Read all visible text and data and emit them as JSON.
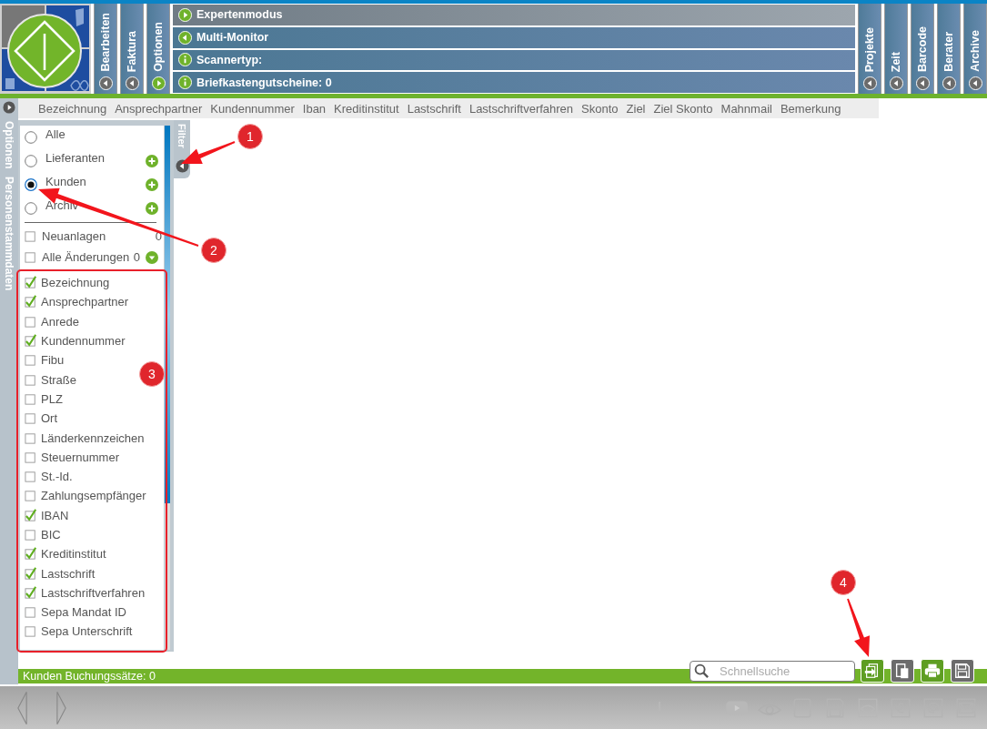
{
  "left_tabs": [
    {
      "label": "Bearbeiten",
      "kind": "back"
    },
    {
      "label": "Faktura",
      "kind": "back"
    },
    {
      "label": "Optionen",
      "kind": "forward"
    }
  ],
  "menu_rows": [
    {
      "label": "Expertenmodus",
      "kind": "forward",
      "highlighted": true
    },
    {
      "label": "Multi-Monitor",
      "kind": "back",
      "highlighted": false
    },
    {
      "label": "Scannertyp:",
      "kind": "info",
      "highlighted": false
    },
    {
      "label": "Briefkastengutscheine: 0",
      "kind": "info",
      "highlighted": false
    }
  ],
  "right_tabs": [
    {
      "label": "Projekte",
      "kind": "back"
    },
    {
      "label": "Zeit",
      "kind": "back"
    },
    {
      "label": "Barcode",
      "kind": "back"
    },
    {
      "label": "Berater",
      "kind": "back"
    },
    {
      "label": "Archive",
      "kind": "back"
    }
  ],
  "columns": [
    "Bezeichnung",
    "Ansprechpartner",
    "Kundennummer",
    "Iban",
    "Kreditinstitut",
    "Lastschrift",
    "Lastschriftverfahren",
    "Skonto",
    "Ziel",
    "Ziel Skonto",
    "Mahnmail",
    "Bemerkung"
  ],
  "side_strip": [
    "Optionen",
    "Personenstammdaten"
  ],
  "filter": {
    "tab_label": "Filter",
    "categories": [
      {
        "label": "Alle",
        "selected": false,
        "addable": false
      },
      {
        "label": "Lieferanten",
        "selected": false,
        "addable": true
      },
      {
        "label": "Kunden",
        "selected": true,
        "addable": true
      },
      {
        "label": "Archiv",
        "selected": false,
        "addable": true
      }
    ],
    "flags": [
      {
        "label": "Neuanlagen",
        "count": "0",
        "checked": false,
        "expandable": false
      },
      {
        "label": "Alle Änderungen",
        "count": "0",
        "checked": false,
        "expandable": true
      }
    ],
    "fields": [
      {
        "label": "Bezeichnung",
        "checked": true
      },
      {
        "label": "Ansprechpartner",
        "checked": true
      },
      {
        "label": "Anrede",
        "checked": false
      },
      {
        "label": "Kundennummer",
        "checked": true
      },
      {
        "label": "Fibu",
        "checked": false
      },
      {
        "label": "Straße",
        "checked": false
      },
      {
        "label": "PLZ",
        "checked": false
      },
      {
        "label": "Ort",
        "checked": false
      },
      {
        "label": "Länderkennzeichen",
        "checked": false
      },
      {
        "label": "Steuernummer",
        "checked": false
      },
      {
        "label": "St.-Id.",
        "checked": false
      },
      {
        "label": "Zahlungsempfänger",
        "checked": false
      },
      {
        "label": "IBAN",
        "checked": true
      },
      {
        "label": "BIC",
        "checked": false
      },
      {
        "label": "Kreditinstitut",
        "checked": true
      },
      {
        "label": "Lastschrift",
        "checked": true
      },
      {
        "label": "Lastschriftverfahren",
        "checked": true
      },
      {
        "label": "Sepa Mandat ID",
        "checked": false
      },
      {
        "label": "Sepa Unterschrift",
        "checked": false
      }
    ]
  },
  "status_bar": {
    "text": "Kunden Buchungssätze: 0"
  },
  "search": {
    "placeholder": "Schnellsuche"
  },
  "actions": [
    {
      "kind": "export"
    },
    {
      "kind": "copy"
    },
    {
      "kind": "print"
    },
    {
      "kind": "save"
    }
  ],
  "annotations": [
    {
      "number": "1"
    },
    {
      "number": "2"
    },
    {
      "number": "3"
    },
    {
      "number": "4"
    }
  ]
}
